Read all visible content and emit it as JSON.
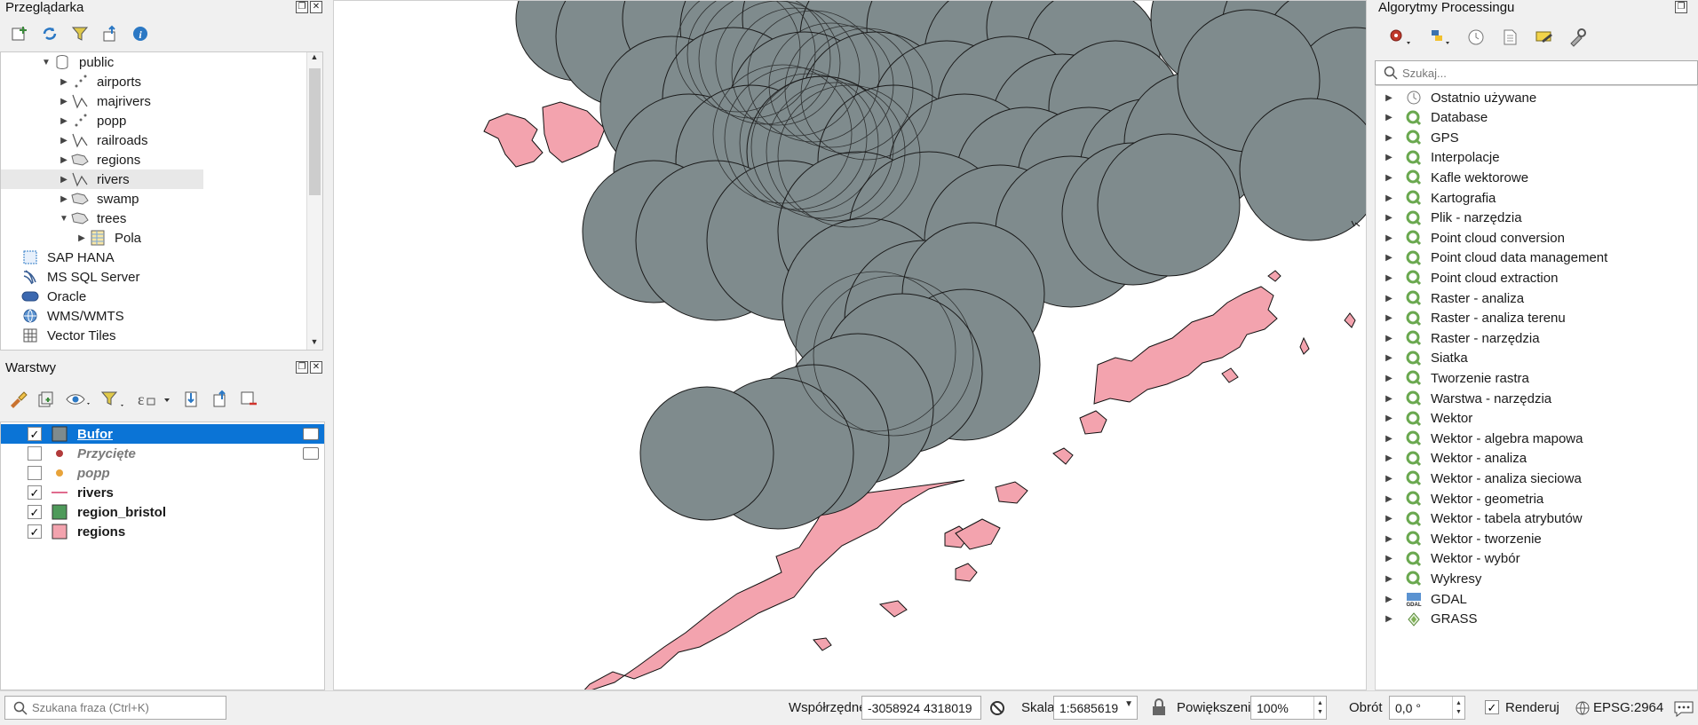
{
  "browser": {
    "title": "Przeglądarka",
    "tree": [
      {
        "label": "public",
        "expanded": true,
        "icon": "database-icon"
      },
      {
        "label": "airports",
        "icon": "point-layer-icon"
      },
      {
        "label": "majrivers",
        "icon": "line-layer-icon"
      },
      {
        "label": "popp",
        "icon": "point-layer-icon"
      },
      {
        "label": "railroads",
        "icon": "line-layer-icon"
      },
      {
        "label": "regions",
        "icon": "polygon-layer-icon"
      },
      {
        "label": "rivers",
        "icon": "line-layer-icon"
      },
      {
        "label": "swamp",
        "icon": "polygon-layer-icon"
      },
      {
        "label": "trees",
        "expanded": true,
        "icon": "polygon-layer-icon"
      },
      {
        "label": "Pola",
        "icon": "table-icon"
      },
      {
        "label": "SAP HANA",
        "icon": "sap-hana-icon"
      },
      {
        "label": "MS SQL Server",
        "icon": "mssql-icon"
      },
      {
        "label": "Oracle",
        "icon": "oracle-icon"
      },
      {
        "label": "WMS/WMTS",
        "icon": "globe-icon"
      },
      {
        "label": "Vector Tiles",
        "icon": "grid-icon"
      }
    ]
  },
  "layers": {
    "title": "Warstwy",
    "items": [
      {
        "name": "Bufor",
        "checked": true,
        "symbol": "polygon-fill",
        "color": "#7f8b8d",
        "selected": true,
        "italic": false,
        "memory": true
      },
      {
        "name": "Przycięte",
        "checked": false,
        "symbol": "point",
        "color": "#b23b3b",
        "italic": true,
        "memory": true
      },
      {
        "name": "popp",
        "checked": false,
        "symbol": "point",
        "color": "#e8a33a",
        "italic": true
      },
      {
        "name": "rivers",
        "checked": true,
        "symbol": "line",
        "color": "#e06b8e"
      },
      {
        "name": "region_bristol",
        "checked": true,
        "symbol": "polygon-fill",
        "color": "#4e9a5a"
      },
      {
        "name": "regions",
        "checked": true,
        "symbol": "polygon-fill",
        "color": "#f3a3ae"
      }
    ]
  },
  "processing": {
    "title": "Algorytmy Processingu",
    "search_placeholder": "Szukaj...",
    "items": [
      {
        "label": "Ostatnio używane",
        "icon": "clock-icon"
      },
      {
        "label": "Database",
        "icon": "qgis-icon"
      },
      {
        "label": "GPS",
        "icon": "qgis-icon"
      },
      {
        "label": "Interpolacje",
        "icon": "qgis-icon"
      },
      {
        "label": "Kafle wektorowe",
        "icon": "qgis-icon"
      },
      {
        "label": "Kartografia",
        "icon": "qgis-icon"
      },
      {
        "label": "Plik - narzędzia",
        "icon": "qgis-icon"
      },
      {
        "label": "Point cloud conversion",
        "icon": "qgis-icon"
      },
      {
        "label": "Point cloud data management",
        "icon": "qgis-icon"
      },
      {
        "label": "Point cloud extraction",
        "icon": "qgis-icon"
      },
      {
        "label": "Raster - analiza",
        "icon": "qgis-icon"
      },
      {
        "label": "Raster - analiza terenu",
        "icon": "qgis-icon"
      },
      {
        "label": "Raster - narzędzia",
        "icon": "qgis-icon"
      },
      {
        "label": "Siatka",
        "icon": "qgis-icon"
      },
      {
        "label": "Tworzenie rastra",
        "icon": "qgis-icon"
      },
      {
        "label": "Warstwa - narzędzia",
        "icon": "qgis-icon"
      },
      {
        "label": "Wektor",
        "icon": "qgis-icon"
      },
      {
        "label": "Wektor - algebra mapowa",
        "icon": "qgis-icon"
      },
      {
        "label": "Wektor - analiza",
        "icon": "qgis-icon"
      },
      {
        "label": "Wektor - analiza sieciowa",
        "icon": "qgis-icon"
      },
      {
        "label": "Wektor - geometria",
        "icon": "qgis-icon"
      },
      {
        "label": "Wektor - tabela atrybutów",
        "icon": "qgis-icon"
      },
      {
        "label": "Wektor - tworzenie",
        "icon": "qgis-icon"
      },
      {
        "label": "Wektor - wybór",
        "icon": "qgis-icon"
      },
      {
        "label": "Wykresy",
        "icon": "qgis-icon"
      },
      {
        "label": "GDAL",
        "icon": "gdal-icon"
      },
      {
        "label": "GRASS",
        "icon": "grass-icon"
      }
    ]
  },
  "status": {
    "search_placeholder": "Szukana fraza (Ctrl+K)",
    "coords_label": "Współrzędne",
    "coords_value": "-3058924  4318019",
    "scale_label": "Skala",
    "scale_value": "1:5685619",
    "magnifier_label": "Powiększenie",
    "magnifier_value": "100%",
    "rotation_label": "Obrót",
    "rotation_value": "0,0 °",
    "render_label": "Renderuj",
    "render_checked": true,
    "crs_label": "EPSG:2964"
  },
  "colors": {
    "buffer_fill": "#7f8b8d",
    "land_fill": "#f3a3ae",
    "selection": "#0b74d6",
    "qgis_green": "#6aa84f"
  }
}
